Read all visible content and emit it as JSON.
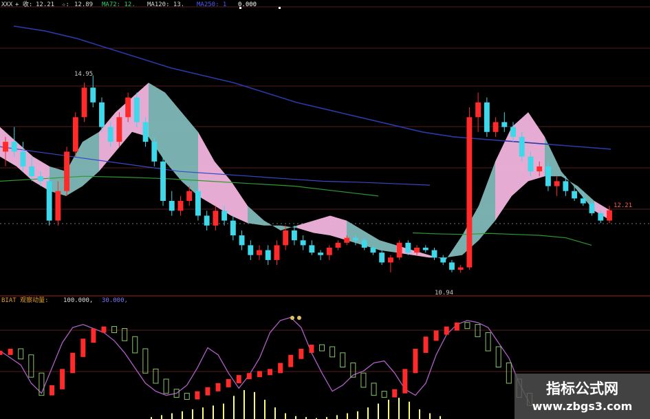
{
  "legend_main": {
    "name": "XXX",
    "c_label": "+ 收:",
    "c_value": "12.21",
    "star_label": "☆:",
    "star_value": "12.89",
    "items": [
      "MA72: 12.",
      "MA120: 13.",
      "MA250: 1",
      "0.000"
    ],
    "colors": [
      "#2ad26a",
      "#d8d8d8",
      "#4b5bff",
      "#ffffff"
    ]
  },
  "legend_sub": {
    "title": "BIAT  观察动量:",
    "v1": "100.000,",
    "v2": "30.000,"
  },
  "labels": {
    "high": "14.95",
    "low": "10.94",
    "last": "12.21"
  },
  "watermark": {
    "line1": "指标公式网",
    "line2": "www.zbgs3.com"
  },
  "colors": {
    "up": "#ff2a2a",
    "down": "#3fd8ea",
    "band_pink": "#f1b4de",
    "band_teal": "#7fb8b8",
    "ma_blue": "#2a3aa8",
    "ma_green": "#2e9a2e",
    "kd_purple": "#b15fc8",
    "kd_green": "#8ac66a",
    "vol_yellow": "#ffff7a",
    "grid": "#5a1a1a"
  },
  "chart_data": {
    "type": "candlestick",
    "price_ylim": [
      10.5,
      16.2
    ],
    "ohlc": [
      [
        13.4,
        13.7,
        13.1,
        13.6
      ],
      [
        13.6,
        13.9,
        13.3,
        13.4
      ],
      [
        13.4,
        13.6,
        13.0,
        13.1
      ],
      [
        13.1,
        13.3,
        12.8,
        12.9
      ],
      [
        12.9,
        13.0,
        12.7,
        12.8
      ],
      [
        12.8,
        12.9,
        11.9,
        12.0
      ],
      [
        12.0,
        12.8,
        11.9,
        12.6
      ],
      [
        12.6,
        13.5,
        12.5,
        13.4
      ],
      [
        13.4,
        14.2,
        13.3,
        14.1
      ],
      [
        14.1,
        14.8,
        14.0,
        14.7
      ],
      [
        14.7,
        14.95,
        14.3,
        14.4
      ],
      [
        14.4,
        14.5,
        13.8,
        13.9
      ],
      [
        13.9,
        14.0,
        13.5,
        13.6
      ],
      [
        13.6,
        14.2,
        13.5,
        14.1
      ],
      [
        14.1,
        14.6,
        14.0,
        14.5
      ],
      [
        14.5,
        14.6,
        13.9,
        14.0
      ],
      [
        14.0,
        14.1,
        13.5,
        13.6
      ],
      [
        13.6,
        13.7,
        13.1,
        13.2
      ],
      [
        13.2,
        13.3,
        12.3,
        12.4
      ],
      [
        12.4,
        12.6,
        12.1,
        12.2
      ],
      [
        12.2,
        12.5,
        12.1,
        12.4
      ],
      [
        12.4,
        12.7,
        12.3,
        12.6
      ],
      [
        12.6,
        12.7,
        12.0,
        12.1
      ],
      [
        12.1,
        12.2,
        11.8,
        11.9
      ],
      [
        11.9,
        12.3,
        11.8,
        12.2
      ],
      [
        12.2,
        12.3,
        11.9,
        12.0
      ],
      [
        12.0,
        12.1,
        11.6,
        11.7
      ],
      [
        11.7,
        11.8,
        11.4,
        11.5
      ],
      [
        11.5,
        11.6,
        11.2,
        11.3
      ],
      [
        11.3,
        11.5,
        11.2,
        11.4
      ],
      [
        11.4,
        11.5,
        11.1,
        11.2
      ],
      [
        11.2,
        11.6,
        11.1,
        11.5
      ],
      [
        11.5,
        11.9,
        11.4,
        11.8
      ],
      [
        11.8,
        11.9,
        11.5,
        11.6
      ],
      [
        11.6,
        11.7,
        11.4,
        11.5
      ],
      [
        11.5,
        11.6,
        11.3,
        11.35
      ],
      [
        11.35,
        11.4,
        11.2,
        11.3
      ],
      [
        11.3,
        11.5,
        11.2,
        11.45
      ],
      [
        11.45,
        11.6,
        11.4,
        11.55
      ],
      [
        11.55,
        11.7,
        11.5,
        11.65
      ],
      [
        11.65,
        11.7,
        11.5,
        11.6
      ],
      [
        11.6,
        11.65,
        11.4,
        11.45
      ],
      [
        11.45,
        11.5,
        11.3,
        11.35
      ],
      [
        11.35,
        11.4,
        11.1,
        11.15
      ],
      [
        11.15,
        11.3,
        10.95,
        11.25
      ],
      [
        11.25,
        11.6,
        11.2,
        11.55
      ],
      [
        11.55,
        11.6,
        11.3,
        11.35
      ],
      [
        11.35,
        11.5,
        11.3,
        11.45
      ],
      [
        11.45,
        11.5,
        11.35,
        11.4
      ],
      [
        11.4,
        11.45,
        11.2,
        11.25
      ],
      [
        11.25,
        11.3,
        11.1,
        11.15
      ],
      [
        11.15,
        11.2,
        10.95,
        11.0
      ],
      [
        11.0,
        11.1,
        10.94,
        11.05
      ],
      [
        11.05,
        14.3,
        11.0,
        14.1
      ],
      [
        14.1,
        14.6,
        13.8,
        14.4
      ],
      [
        14.4,
        14.5,
        13.7,
        13.8
      ],
      [
        13.8,
        14.1,
        13.7,
        14.0
      ],
      [
        14.0,
        14.2,
        13.8,
        13.9
      ],
      [
        13.9,
        14.0,
        13.6,
        13.7
      ],
      [
        13.7,
        13.8,
        13.2,
        13.3
      ],
      [
        13.3,
        13.4,
        12.9,
        13.0
      ],
      [
        13.0,
        13.2,
        12.9,
        13.1
      ],
      [
        13.1,
        13.2,
        12.6,
        12.7
      ],
      [
        12.7,
        12.9,
        12.5,
        12.8
      ],
      [
        12.8,
        12.9,
        12.5,
        12.6
      ],
      [
        12.6,
        12.7,
        12.4,
        12.45
      ],
      [
        12.45,
        12.6,
        12.3,
        12.35
      ],
      [
        12.35,
        12.4,
        12.1,
        12.15
      ],
      [
        12.15,
        12.2,
        11.95,
        12.0
      ],
      [
        12.0,
        12.3,
        11.95,
        12.21
      ]
    ],
    "band_upper": [
      13.9,
      13.6,
      13.3,
      13.1,
      13.0,
      13.6,
      13.8,
      14.2,
      14.5,
      14.8,
      14.6,
      14.2,
      13.8,
      13.2,
      12.8,
      12.3,
      12.0,
      11.8,
      11.9,
      12.0,
      12.1,
      12.0,
      11.8,
      11.6,
      11.5,
      11.4,
      11.3,
      11.2,
      11.7,
      12.3,
      13.2,
      13.9,
      14.2,
      13.7,
      13.0,
      12.6,
      12.2,
      12.0
    ],
    "band_lower": [
      13.3,
      13.1,
      12.8,
      12.6,
      12.5,
      12.7,
      13.0,
      13.4,
      13.8,
      13.7,
      13.2,
      12.8,
      12.5,
      12.3,
      12.1,
      11.95,
      11.9,
      11.9,
      11.85,
      11.75,
      11.7,
      11.6,
      11.5,
      11.4,
      11.35,
      11.3,
      11.25,
      11.25,
      11.3,
      11.6,
      12.0,
      12.5,
      12.8,
      12.9,
      12.9,
      12.7,
      12.4,
      12.2
    ],
    "ma_blue_long": [
      15.95,
      15.85,
      15.7,
      15.5,
      15.3,
      15.1,
      14.95,
      14.8,
      14.6,
      14.4,
      14.25,
      14.1,
      13.95,
      13.8,
      13.7,
      13.65,
      13.6,
      13.55,
      13.5,
      13.45
    ],
    "ma_blue_mid": [
      13.5,
      13.4,
      13.3,
      13.2,
      13.1,
      13.0,
      12.95,
      12.9,
      12.85,
      12.8,
      12.78,
      12.75,
      12.72
    ],
    "ma_green": [
      12.8,
      12.85,
      12.9,
      12.88,
      12.85,
      12.8,
      12.75,
      12.7,
      12.6,
      12.5
    ],
    "ma_green2": [
      11.75,
      11.73,
      11.72,
      11.74,
      11.72,
      11.7,
      11.65,
      11.5
    ],
    "kd_line": [
      62,
      55,
      48,
      30,
      20,
      45,
      70,
      85,
      88,
      84,
      80,
      72,
      60,
      45,
      30,
      22,
      18,
      20,
      28,
      45,
      65,
      58,
      40,
      25,
      38,
      55,
      80,
      92,
      95,
      85,
      60,
      40,
      22,
      28,
      38,
      42,
      50,
      52,
      40,
      24,
      18,
      30,
      58,
      78,
      88,
      92,
      90,
      85,
      70,
      55,
      30,
      10
    ],
    "kd_bars": [
      62,
      64,
      58,
      40,
      22,
      28,
      44,
      60,
      74,
      84,
      86,
      84,
      76,
      64,
      44,
      34,
      24,
      20,
      18,
      22,
      26,
      30,
      34,
      38,
      40,
      42,
      44,
      50,
      58,
      64,
      68,
      66,
      60,
      50,
      40,
      30,
      22,
      20,
      24,
      44,
      64,
      76,
      82,
      86,
      90,
      88,
      80,
      66,
      50,
      34,
      20,
      12
    ],
    "vol_bars": [
      2,
      4,
      6,
      8,
      10,
      12,
      14,
      16,
      24,
      30,
      28,
      20,
      12,
      6,
      3,
      2,
      1,
      2,
      4,
      6,
      8,
      12,
      16,
      20,
      22,
      18,
      10,
      6,
      3
    ]
  }
}
